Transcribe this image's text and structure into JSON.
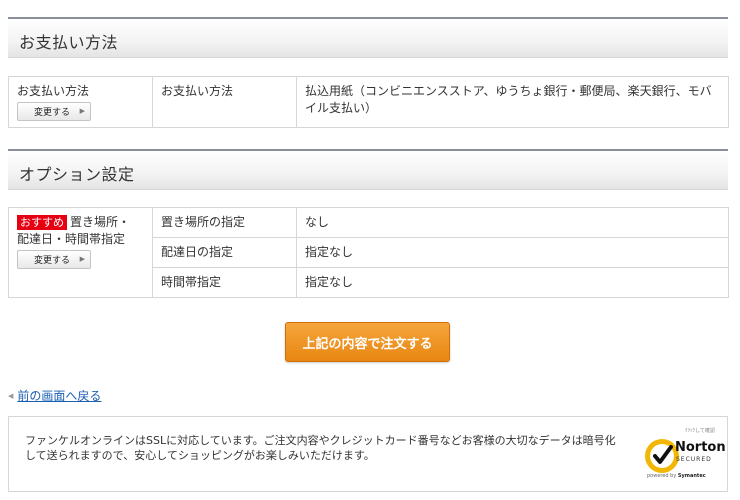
{
  "payment_section": {
    "title": "お支払い方法",
    "row": {
      "label": "お支払い方法",
      "change_label": "変更する",
      "field": "お支払い方法",
      "value": "払込用紙（コンビニエンスストア、ゆうちょ銀行・郵便局、楽天銀行、モバイル支払い）"
    }
  },
  "option_section": {
    "title": "オプション設定",
    "badge": "おすすめ",
    "label_line1": "置き場所・",
    "label_line2": "配達日・時間帯指定",
    "change_label": "変更する",
    "rows": [
      {
        "field": "置き場所の指定",
        "value": "なし"
      },
      {
        "field": "配達日の指定",
        "value": "指定なし"
      },
      {
        "field": "時間帯指定",
        "value": "指定なし"
      }
    ]
  },
  "order_button": {
    "label": "上記の内容で注文する"
  },
  "back_link": {
    "label": "前の画面へ戻る"
  },
  "ssl_notice": {
    "text": "ファンケルオンラインはSSLに対応しています。ご注文内容やクレジットカード番号などお客様の大切なデータは暗号化して送られますので、安心してショッピングがお楽しみいただけます。"
  },
  "norton_seal": {
    "tagline": "ｸﾘｯｸして確認",
    "brand": "Norton",
    "secured": "SECURED",
    "powered_prefix": "powered by",
    "powered_brand": "Symantec"
  },
  "colors": {
    "badge_red": "#e60012",
    "order_orange": "#e88612",
    "link_blue": "#1a5fb4",
    "norton_yellow": "#f2b705"
  }
}
